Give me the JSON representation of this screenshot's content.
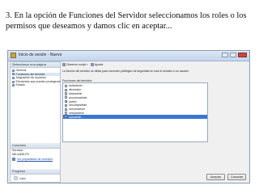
{
  "slide": {
    "caption": "3. En la opción de Funciones del Servidor seleccionamos los roles o los permisos que deseamos y damos clic en aceptar..."
  },
  "window": {
    "title": "Inicio de sesión - Nuevo"
  },
  "left_pane": {
    "header": "Seleccionar una página",
    "pages": [
      {
        "label": "General",
        "selected": false
      },
      {
        "label": "Funciones del servidor",
        "selected": true
      },
      {
        "label": "Asignación de usuarios",
        "selected": false
      },
      {
        "label": "Elementos que pueden protegerse",
        "selected": false
      },
      {
        "label": "Estado",
        "selected": false
      }
    ],
    "connection_header": "Conexión",
    "connection_server_label": "Servidor:",
    "connection_server_value": "WILIAMS-PC",
    "connection_link": "Ver propiedades de conexión",
    "progress_header": "Progreso",
    "progress_status": "Listo"
  },
  "toolbar": {
    "script_label": "Generar script",
    "help_label": "Ayuda"
  },
  "main": {
    "description": "La función del servidor se utiliza para conceder privilegios de seguridad en todo el servidor a un usuario.",
    "roles_label": "Funciones del servidor:",
    "roles": [
      {
        "name": "bulkadmin",
        "checked": false,
        "selected": false
      },
      {
        "name": "dbcreator",
        "checked": false,
        "selected": false
      },
      {
        "name": "diskadmin",
        "checked": false,
        "selected": false
      },
      {
        "name": "processadmin",
        "checked": false,
        "selected": false
      },
      {
        "name": "public",
        "checked": true,
        "selected": false
      },
      {
        "name": "securityadmin",
        "checked": false,
        "selected": false
      },
      {
        "name": "serveradmin",
        "checked": false,
        "selected": false
      },
      {
        "name": "setupadmin",
        "checked": false,
        "selected": false
      },
      {
        "name": "sysadmin",
        "checked": true,
        "selected": true
      }
    ]
  },
  "footer": {
    "ok_label": "Aceptar",
    "cancel_label": "Cancelar"
  }
}
